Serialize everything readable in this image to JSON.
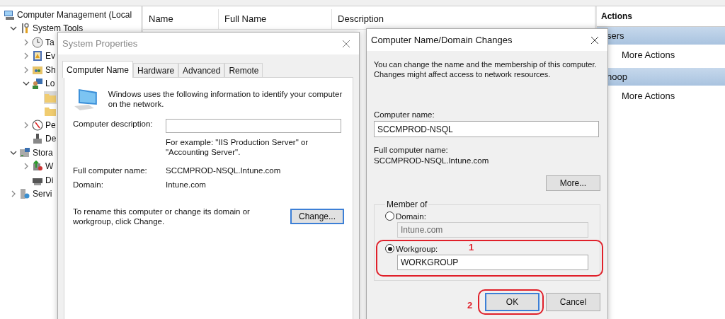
{
  "console": {
    "tree": [
      {
        "label": "Computer Management (Local",
        "kind": "computer",
        "children": [
          {
            "label": "System Tools",
            "kind": "tools",
            "expanded": true,
            "children": [
              {
                "label": "Ta",
                "kind": "clock",
                "expanded": false
              },
              {
                "label": "Ev",
                "kind": "event",
                "expanded": false
              },
              {
                "label": "Sh",
                "kind": "share",
                "expanded": false
              },
              {
                "label": "Lo",
                "kind": "users",
                "expanded": true,
                "children": [
                  {
                    "kind": "folder",
                    "selected": true
                  },
                  {
                    "kind": "folder",
                    "selected": false
                  }
                ]
              },
              {
                "label": "Pe",
                "kind": "gauge",
                "expanded": false
              },
              {
                "label": "De",
                "kind": "device"
              }
            ]
          },
          {
            "label": "Stora",
            "kind": "storage",
            "expanded": true,
            "children": [
              {
                "label": "W",
                "kind": "backup",
                "expanded": false
              },
              {
                "label": "Di",
                "kind": "disk"
              }
            ]
          },
          {
            "label": "Servi",
            "kind": "services",
            "expanded": false
          }
        ]
      }
    ],
    "columns": [
      "Name",
      "Full Name",
      "Description"
    ],
    "actions": {
      "title": "Actions",
      "sections": [
        {
          "title": "sers",
          "items": [
            "More Actions"
          ]
        },
        {
          "title": "noop",
          "items": [
            "More Actions"
          ]
        }
      ]
    }
  },
  "system_properties": {
    "title": "System Properties",
    "tabs": [
      {
        "label": "Computer Name",
        "selected": true
      },
      {
        "label": "Hardware",
        "selected": false
      },
      {
        "label": "Advanced",
        "selected": false
      },
      {
        "label": "Remote",
        "selected": false
      }
    ],
    "intro": "Windows uses the following information to identify your computer on the network.",
    "description_label": "Computer description:",
    "description_hint": "For example: \"IIS Production Server\" or \"Accounting Server\".",
    "full_name_label": "Full computer name:",
    "full_name": "SCCMPROD-NSQL.Intune.com",
    "domain_label": "Domain:",
    "domain": "Intune.com",
    "rename_text": "To rename this computer or change its domain or workgroup, click Change.",
    "change_button": "Change..."
  },
  "domain_changes": {
    "title": "Computer Name/Domain Changes",
    "intro": "You can change the name and the membership of this computer. Changes might affect access to network resources.",
    "computer_name_label": "Computer name:",
    "computer_name": "SCCMPROD-NSQL",
    "full_name_label": "Full computer name:",
    "full_name": "SCCMPROD-NSQL.Intune.com",
    "more_button": "More...",
    "member_of": "Member of",
    "options": [
      {
        "label": "Domain:",
        "value": "Intune.com",
        "selected": false
      },
      {
        "label": "Workgroup:",
        "value": "WORKGROUP",
        "selected": true
      }
    ],
    "buttons": [
      {
        "label": "OK",
        "default": true
      },
      {
        "label": "Cancel",
        "default": false
      }
    ]
  },
  "annotations": [
    {
      "label": "1"
    },
    {
      "label": "2"
    }
  ]
}
